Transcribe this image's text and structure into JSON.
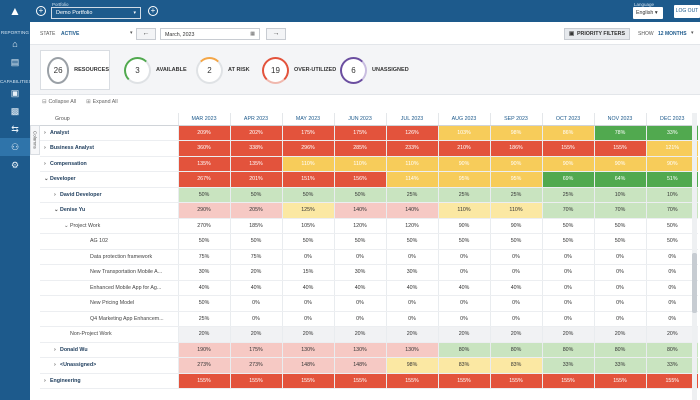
{
  "nav": {
    "sections": [
      "REPORTING",
      "CAPABILITIES"
    ]
  },
  "header": {
    "portfolio_label": "Portfolio",
    "portfolio_value": "Demo Portfolio",
    "language_label": "Language",
    "language_value": "English",
    "logout_label": "LOG OUT"
  },
  "filters": {
    "state_label": "STATE",
    "state_value": "ACTIVE",
    "month_value": "March, 2023",
    "priority_label": "PRIORITY FILTERS",
    "show_label": "SHOW",
    "show_value": "12 MONTHS"
  },
  "summary": [
    {
      "count": "26",
      "label": "RESOURCES",
      "color": "#9aa0a6"
    },
    {
      "count": "3",
      "label": "AVAILABLE",
      "color": "#51a94f"
    },
    {
      "count": "2",
      "label": "AT RISK",
      "color": "#f3a648"
    },
    {
      "count": "19",
      "label": "OVER-UTILIZED",
      "color": "#e3533c"
    },
    {
      "count": "6",
      "label": "UNASSIGNED",
      "color": "#6b4ea0"
    }
  ],
  "grid": {
    "collapse_all": "Collapse All",
    "expand_all": "Expand All",
    "columns_tab": "Columns",
    "group_header": "Group",
    "months": [
      "MAR 2023",
      "APR 2023",
      "MAY 2023",
      "JUN 2023",
      "JUL 2023",
      "AUG 2023",
      "SEP 2023",
      "OCT 2023",
      "NOV 2023",
      "DEC 2023"
    ],
    "rows": [
      {
        "name": "Analyst",
        "arrow": "›",
        "indent": 0,
        "style": "bold",
        "values": [
          "209%",
          "202%",
          "175%",
          "175%",
          "126%",
          "103%",
          "98%",
          "86%",
          "78%",
          "33%"
        ],
        "colors": [
          "r",
          "r",
          "r",
          "r",
          "r",
          "y",
          "y",
          "y",
          "dg",
          "dg"
        ]
      },
      {
        "name": "Business Analyst",
        "arrow": "›",
        "indent": 0,
        "style": "bold",
        "values": [
          "360%",
          "338%",
          "296%",
          "285%",
          "233%",
          "210%",
          "186%",
          "155%",
          "155%",
          "121%"
        ],
        "colors": [
          "r",
          "r",
          "r",
          "r",
          "r",
          "r",
          "r",
          "r",
          "r",
          "y"
        ]
      },
      {
        "name": "Compensation",
        "arrow": "›",
        "indent": 0,
        "style": "bold",
        "values": [
          "135%",
          "135%",
          "110%",
          "110%",
          "110%",
          "90%",
          "90%",
          "90%",
          "90%",
          "90%"
        ],
        "colors": [
          "r",
          "r",
          "y",
          "y",
          "y",
          "y",
          "y",
          "y",
          "y",
          "y"
        ]
      },
      {
        "name": "Developer",
        "arrow": "⌄",
        "indent": 0,
        "style": "bold",
        "values": [
          "267%",
          "201%",
          "151%",
          "156%",
          "114%",
          "95%",
          "95%",
          "69%",
          "64%",
          "51%"
        ],
        "colors": [
          "r",
          "r",
          "r",
          "r",
          "y",
          "y",
          "y",
          "dg",
          "dg",
          "dg"
        ]
      },
      {
        "name": "David Developer",
        "arrow": "›",
        "indent": 1,
        "style": "bold",
        "values": [
          "50%",
          "50%",
          "50%",
          "50%",
          "25%",
          "25%",
          "25%",
          "25%",
          "10%",
          "10%"
        ],
        "colors": [
          "pg",
          "pg",
          "pg",
          "pg",
          "pg",
          "pg",
          "pg",
          "pg",
          "pg",
          "pg"
        ]
      },
      {
        "name": "Denise Yu",
        "arrow": "⌄",
        "indent": 1,
        "style": "bold",
        "values": [
          "290%",
          "205%",
          "125%",
          "140%",
          "140%",
          "110%",
          "110%",
          "70%",
          "70%",
          "70%"
        ],
        "colors": [
          "pr",
          "pr",
          "py",
          "pr",
          "pr",
          "py",
          "py",
          "pg",
          "pg",
          "pg"
        ]
      },
      {
        "name": "Project Work",
        "arrow": "⌄",
        "indent": 2,
        "style": "gray",
        "values": [
          "270%",
          "185%",
          "105%",
          "120%",
          "120%",
          "90%",
          "90%",
          "50%",
          "50%",
          "50%"
        ],
        "colors": [
          "w",
          "w",
          "w",
          "w",
          "w",
          "w",
          "w",
          "w",
          "w",
          "w"
        ]
      },
      {
        "name": "AG 102",
        "arrow": "",
        "indent": 3,
        "style": "gray",
        "values": [
          "50%",
          "50%",
          "50%",
          "50%",
          "50%",
          "50%",
          "50%",
          "50%",
          "50%",
          "50%"
        ],
        "colors": [
          "w",
          "w",
          "w",
          "w",
          "w",
          "w",
          "w",
          "w",
          "w",
          "w"
        ]
      },
      {
        "name": "Data protection framework",
        "arrow": "",
        "indent": 3,
        "style": "gray",
        "values": [
          "75%",
          "75%",
          "0%",
          "0%",
          "0%",
          "0%",
          "0%",
          "0%",
          "0%",
          "0%"
        ],
        "colors": [
          "w",
          "w",
          "w",
          "w",
          "w",
          "w",
          "w",
          "w",
          "w",
          "w"
        ]
      },
      {
        "name": "New Transportation Mobile A...",
        "arrow": "",
        "indent": 3,
        "style": "gray",
        "values": [
          "30%",
          "20%",
          "15%",
          "30%",
          "30%",
          "0%",
          "0%",
          "0%",
          "0%",
          "0%"
        ],
        "colors": [
          "w",
          "w",
          "w",
          "w",
          "w",
          "w",
          "w",
          "w",
          "w",
          "w"
        ]
      },
      {
        "name": "Enhanced Mobile App for Ag...",
        "arrow": "",
        "indent": 3,
        "style": "gray",
        "values": [
          "40%",
          "40%",
          "40%",
          "40%",
          "40%",
          "40%",
          "40%",
          "0%",
          "0%",
          "0%"
        ],
        "colors": [
          "w",
          "w",
          "w",
          "w",
          "w",
          "w",
          "w",
          "w",
          "w",
          "w"
        ]
      },
      {
        "name": "New Pricing Model",
        "arrow": "",
        "indent": 3,
        "style": "gray",
        "values": [
          "50%",
          "0%",
          "0%",
          "0%",
          "0%",
          "0%",
          "0%",
          "0%",
          "0%",
          "0%"
        ],
        "colors": [
          "w",
          "w",
          "w",
          "w",
          "w",
          "w",
          "w",
          "w",
          "w",
          "w"
        ]
      },
      {
        "name": "Q4 Marketing App Enhancem...",
        "arrow": "",
        "indent": 3,
        "style": "gray",
        "values": [
          "25%",
          "0%",
          "0%",
          "0%",
          "0%",
          "0%",
          "0%",
          "0%",
          "0%",
          "0%"
        ],
        "colors": [
          "w",
          "w",
          "w",
          "w",
          "w",
          "w",
          "w",
          "w",
          "w",
          "w"
        ]
      },
      {
        "name": "Non-Project Work",
        "arrow": "",
        "indent": 2,
        "style": "gray",
        "values": [
          "20%",
          "20%",
          "20%",
          "20%",
          "20%",
          "20%",
          "20%",
          "20%",
          "20%",
          "20%"
        ],
        "colors": [
          "lg",
          "lg",
          "lg",
          "lg",
          "lg",
          "lg",
          "lg",
          "lg",
          "lg",
          "lg"
        ]
      },
      {
        "name": "Donald Wu",
        "arrow": "›",
        "indent": 1,
        "style": "bold",
        "values": [
          "190%",
          "175%",
          "130%",
          "130%",
          "130%",
          "80%",
          "80%",
          "80%",
          "80%",
          "80%"
        ],
        "colors": [
          "pr",
          "pr",
          "pr",
          "pr",
          "pr",
          "pg",
          "pg",
          "pg",
          "pg",
          "pg"
        ]
      },
      {
        "name": "<Unassigned>",
        "arrow": "›",
        "indent": 1,
        "style": "bold",
        "values": [
          "273%",
          "273%",
          "148%",
          "148%",
          "98%",
          "83%",
          "83%",
          "33%",
          "33%",
          "33%"
        ],
        "colors": [
          "pr",
          "pr",
          "pr",
          "pr",
          "py",
          "py",
          "py",
          "pg",
          "pg",
          "pg"
        ]
      },
      {
        "name": "Engineering",
        "arrow": "›",
        "indent": 0,
        "style": "bold",
        "values": [
          "155%",
          "155%",
          "155%",
          "155%",
          "155%",
          "155%",
          "155%",
          "155%",
          "155%",
          "155%"
        ],
        "colors": [
          "r",
          "r",
          "r",
          "r",
          "r",
          "r",
          "r",
          "r",
          "r",
          "r"
        ]
      }
    ]
  },
  "colors": {
    "brand": "#1d5a8c",
    "over": "#e3533c",
    "risk": "#f3a648",
    "ok": "#51a94f"
  }
}
